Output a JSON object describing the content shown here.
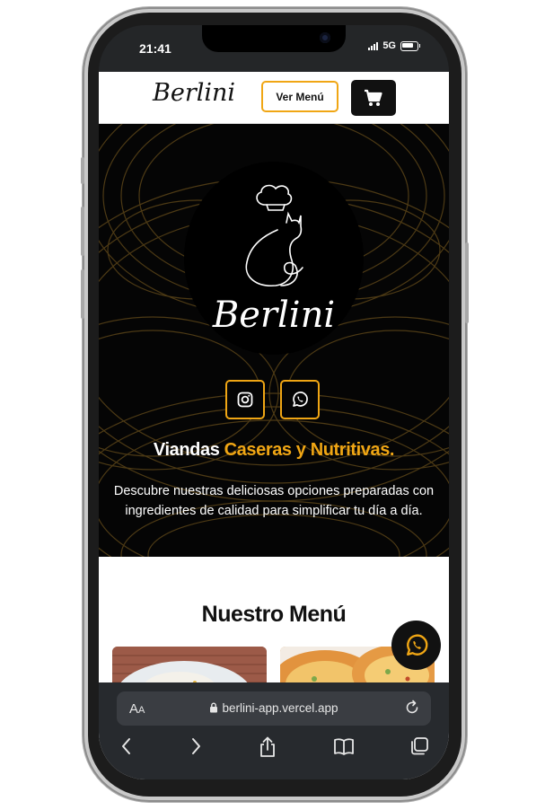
{
  "status_bar": {
    "time": "21:41",
    "network": "5G"
  },
  "nav": {
    "brand": "Berlini",
    "menu_button": "Ver Menú"
  },
  "hero": {
    "logo_text": "Berlini",
    "headline_plain": "Viandas ",
    "headline_accent": "Caseras y Nutritivas.",
    "description": "Descubre nuestras deliciosas opciones preparadas con ingredientes de calidad para simplificar tu día a día."
  },
  "menu": {
    "title": "Nuestro Menú"
  },
  "browser": {
    "aa_big": "A",
    "aa_small": "A",
    "url": "berlini-app.vercel.app"
  },
  "icons": [
    "cart-icon",
    "instagram-icon",
    "whatsapp-icon",
    "lock-icon",
    "reload-icon",
    "back-icon",
    "forward-icon",
    "share-icon",
    "bookmarks-icon",
    "tabs-icon"
  ],
  "colors": {
    "accent": "#f0a614",
    "dark": "#050505",
    "nav_bg": "#ffffff",
    "browser_bg": "#272a2e"
  }
}
